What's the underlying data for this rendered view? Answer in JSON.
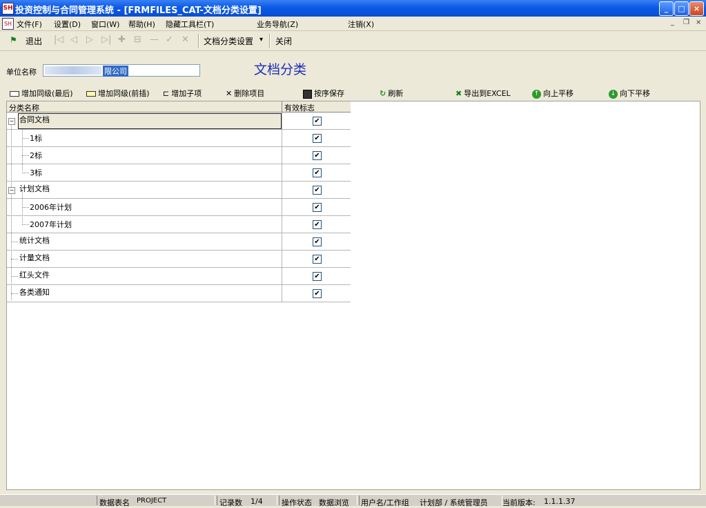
{
  "window": {
    "icon_text": "SH",
    "title": "投资控制与合同管理系统 - [FRMFILES_CAT-文档分类设置]",
    "minimize_glyph": "_",
    "maximize_glyph": "□",
    "close_glyph": "×"
  },
  "menu": {
    "items": [
      "文件(F)",
      "设置(D)",
      "窗口(W)",
      "帮助(H)",
      "隐藏工具栏(T)",
      "业务导航(Z)",
      "注销(X)"
    ],
    "mdi_min": "_",
    "mdi_restore": "❐",
    "mdi_close": "×"
  },
  "toolbar": {
    "exit_glyph": "⚑",
    "exit_label": "退出",
    "nav_glyphs": [
      "|◁",
      "◁",
      "▷",
      "▷|",
      "✚",
      "⊟",
      "—",
      "✓",
      "✕"
    ],
    "dropdown_label": "文档分类设置",
    "dropdown_arrow": "▾",
    "close_label": "关闭"
  },
  "form": {
    "unit_label": "单位名称",
    "unit_value_visible": "限公司",
    "heading": "文档分类"
  },
  "actions": {
    "add_sibling_last": "增加同级(最后)",
    "add_sibling_insert": "增加同级(前插)",
    "add_child_glyph": "⊏",
    "add_child": "增加子项",
    "delete_glyph": "✕",
    "delete": "删除项目",
    "save_order": "按序保存",
    "refresh_glyph": "↻",
    "refresh": "刷新",
    "export_glyph": "✖",
    "export": "导出到EXCEL",
    "move_up_glyph": "↑",
    "move_up": "向上平移",
    "move_down_glyph": "↓",
    "move_down": "向下平移"
  },
  "grid": {
    "col_name": "分类名称",
    "col_flag": "有效标志",
    "expander_glyph": "−",
    "check_glyph": "✔",
    "rows": [
      {
        "name": "合同文档",
        "checked": true
      },
      {
        "name": "1标",
        "checked": true
      },
      {
        "name": "2标",
        "checked": true
      },
      {
        "name": "3标",
        "checked": true
      },
      {
        "name": "计划文档",
        "checked": true
      },
      {
        "name": "2006年计划",
        "checked": true
      },
      {
        "name": "2007年计划",
        "checked": true
      },
      {
        "name": "统计文档",
        "checked": true
      },
      {
        "name": "计量文档",
        "checked": true
      },
      {
        "name": "红头文件",
        "checked": true
      },
      {
        "name": "各类通知",
        "checked": true
      }
    ]
  },
  "status": {
    "table_label": "数据表名",
    "table_value": "PROJECT",
    "records_label": "记录数",
    "records_value": "1/4",
    "op_label": "操作状态",
    "op_value": "数据浏览",
    "user_label": "用户名/工作组",
    "user_value": "计划部 / 系统管理员",
    "version_label": "当前版本:",
    "version_value": "1.1.1.37"
  }
}
